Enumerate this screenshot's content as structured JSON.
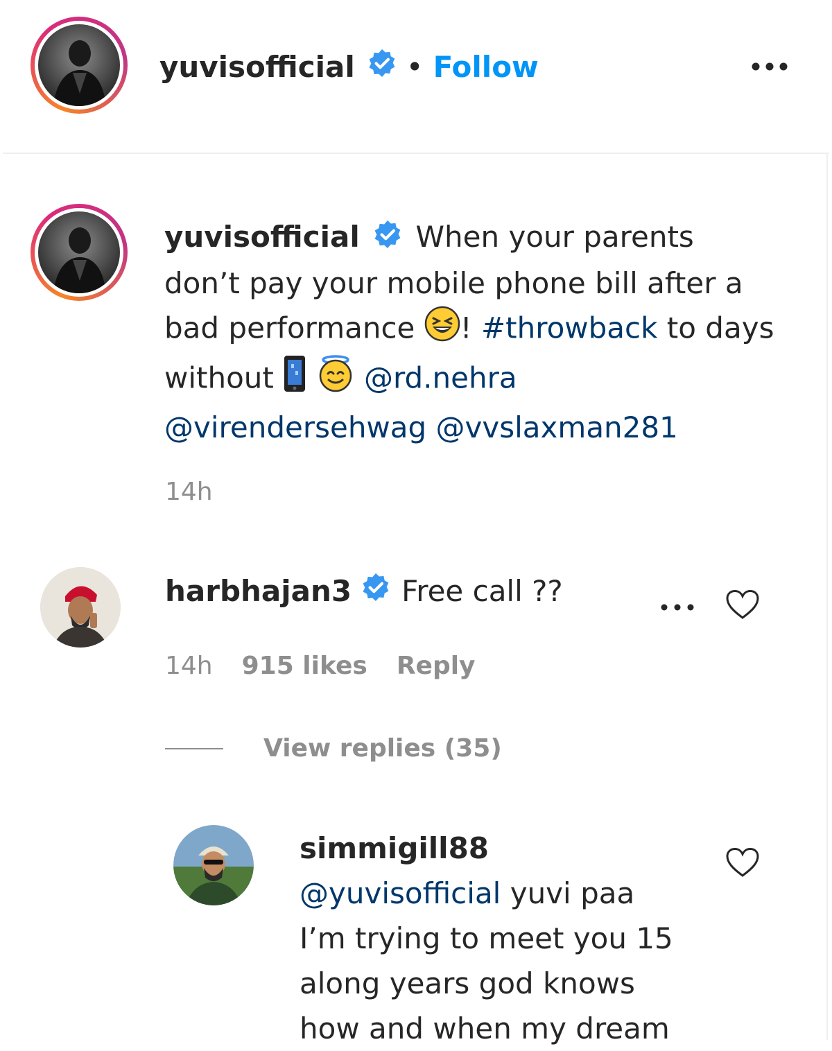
{
  "header": {
    "username": "yuvisofficial",
    "separator": "•",
    "follow_label": "Follow",
    "more_icon": "more-horizontal-icon"
  },
  "post": {
    "username": "yuvisofficial",
    "caption_part1": "When your parents don’t pay your mobile phone bill after a bad performance",
    "caption_part2": "!",
    "hashtag": "#throwback",
    "caption_part3": "to days without",
    "mention1": "@rd.nehra",
    "mention2": "@virendersehwag",
    "mention3": "@vvslaxman281",
    "time": "14h"
  },
  "comments": [
    {
      "username": "harbhajan3",
      "text": "Free call ??",
      "time": "14h",
      "likes": "915 likes",
      "reply_label": "Reply",
      "view_replies": "View replies (35)"
    }
  ],
  "reply": {
    "username": "simmigill88",
    "mention": "@yuvisofficial",
    "text_line1": "yuvi paa",
    "text_line2": "I’m trying to meet you 15",
    "text_line3": "along years god knows",
    "text_line4": "how and when my dream"
  },
  "colors": {
    "link": "#00376b",
    "accent": "#0095f6",
    "muted": "#8e8e8e",
    "verified": "#3897f0"
  }
}
